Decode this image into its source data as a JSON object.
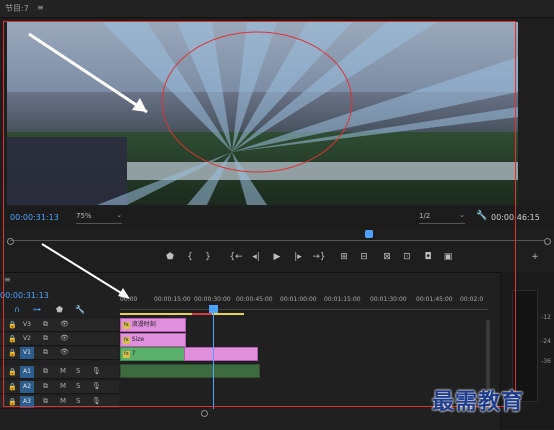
{
  "program_monitor": {
    "title": "节目:7",
    "menu_icon": "≡",
    "current_time": "00:00:31:13",
    "zoom": "75%",
    "resolution": "1/2",
    "duration": "00:00:46:15"
  },
  "transport_icons": [
    "marker-icon",
    "mark-in-icon",
    "mark-out-icon",
    "go-to-in-icon",
    "step-back-icon",
    "play-icon",
    "step-forward-icon",
    "go-to-out-icon",
    "insert-icon",
    "overwrite-icon",
    "lift-icon",
    "extract-icon",
    "compare-icon",
    "camera-icon",
    "export-frame-icon",
    "add-button-icon"
  ],
  "timeline": {
    "menu_icon": "≡",
    "timecode": "00:00:31:13",
    "ruler_labels": [
      "00:00",
      "00:00:15:00",
      "00:00:30:00",
      "00:00:45:00",
      "00:01:00:00",
      "00:01:15:00",
      "00:01:30:00",
      "00:01:45:00",
      "00:02:0"
    ],
    "tracks": [
      {
        "id": "V3",
        "labels": [
          "V3"
        ]
      },
      {
        "id": "V2",
        "labels": [
          "V2"
        ]
      },
      {
        "id": "V1",
        "labels": [
          "V1"
        ]
      },
      {
        "id": "A1",
        "labels": [
          "A1",
          "M",
          "S"
        ]
      },
      {
        "id": "A2",
        "labels": [
          "A2",
          "M",
          "S"
        ]
      },
      {
        "id": "A3",
        "labels": [
          "A3",
          "M",
          "S"
        ]
      }
    ],
    "clips": {
      "v3_title": "浪漫时刻",
      "v3_fx": "fx",
      "v2_title": "Size",
      "v2_fx": "fx",
      "v1_title": "7",
      "v1_fx": "fx"
    }
  },
  "meter": {
    "labels": [
      "-12",
      "-24",
      "-36"
    ]
  },
  "watermark": "最需教育",
  "colors": {
    "accent_blue": "#4da3ff",
    "clip_pink": "#e08fdd",
    "clip_green": "#5ab26a",
    "highlight_red": "#dd3333"
  }
}
